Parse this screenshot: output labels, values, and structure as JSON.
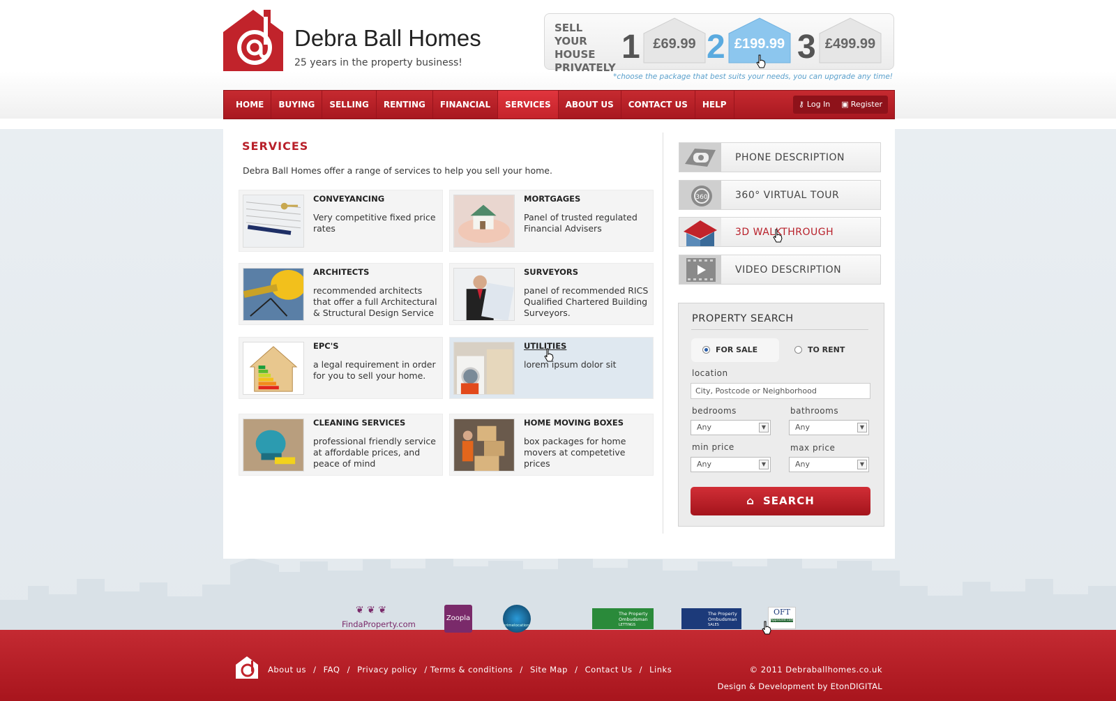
{
  "brand": {
    "name": "Debra Ball Homes",
    "tagline": "25 years in the property business!",
    "logo_icon": "house-at-logo-icon"
  },
  "promo": {
    "heading": "SELL YOUR HOUSE PRIVATELY",
    "packages": [
      {
        "num": "1",
        "price": "£69.99"
      },
      {
        "num": "2",
        "price": "£199.99"
      },
      {
        "num": "3",
        "price": "£499.99"
      }
    ],
    "note": "*choose the package that best suits your needs, you can upgrade any time!"
  },
  "nav": {
    "items": [
      "HOME",
      "BUYING",
      "SELLING",
      "RENTING",
      "FINANCIAL",
      "SERVICES",
      "ABOUT US",
      "CONTACT US",
      "HELP"
    ],
    "active": "SERVICES",
    "login": "Log In",
    "register": "Register"
  },
  "services": {
    "title": "SERVICES",
    "intro": "Debra Ball Homes offer a range of services to help you sell your home.",
    "cards": [
      {
        "title": "CONVEYANCING",
        "desc": "Very competitive fixed price rates"
      },
      {
        "title": "MORTGAGES",
        "desc": "Panel of trusted regulated Financial Advisers"
      },
      {
        "title": "ARCHITECTS",
        "desc": "recommended architects that offer a full Architectural & Structural Design Service"
      },
      {
        "title": "SURVEYORS",
        "desc": "panel of recommended RICS Qualified Chartered Building Surveyors."
      },
      {
        "title": "EPC'S",
        "desc": "a legal requirement in order for you to sell your home."
      },
      {
        "title": "UTILITIES",
        "desc": "lorem ipsum dolor sit"
      },
      {
        "title": "CLEANING SERVICES",
        "desc": "professional friendly service at affordable prices, and peace of mind"
      },
      {
        "title": "HOME MOVING BOXES",
        "desc": "box packages for home movers at competetive prices"
      }
    ]
  },
  "features": [
    {
      "label": "PHONE DESCRIPTION",
      "icon": "phone-icon"
    },
    {
      "label": "360° VIRTUAL TOUR",
      "icon": "360-tour-icon"
    },
    {
      "label": "3D WALKTHROUGH",
      "icon": "3d-house-icon"
    },
    {
      "label": "VIDEO DESCRIPTION",
      "icon": "video-icon"
    }
  ],
  "property_search": {
    "title": "PROPERTY SEARCH",
    "for_sale": "FOR SALE",
    "to_rent": "TO RENT",
    "location_label": "location",
    "location_placeholder": "City, Postcode or Neighborhood",
    "bedrooms_label": "bedrooms",
    "bathrooms_label": "bathrooms",
    "min_price_label": "min price",
    "max_price_label": "max price",
    "bedrooms_value": "Any",
    "bathrooms_value": "Any",
    "min_price_value": "Any",
    "max_price_value": "Any",
    "search_button": "SEARCH"
  },
  "partners": {
    "findaproperty": "FindaProperty.com",
    "zoopla": "Zoopla",
    "primelocation": "primelocation.com",
    "ombudsman_lettings_1": "The Property",
    "ombudsman_lettings_2": "Ombudsman",
    "ombudsman_lettings_3": "LETTINGS",
    "ombudsman_sales_1": "The Property",
    "ombudsman_sales_2": "Ombudsman",
    "ombudsman_sales_3": "SALES",
    "oft": "OFT",
    "oft_sub": "Approved code"
  },
  "footer": {
    "links": [
      "About us",
      "/",
      "FAQ",
      "/",
      "Privacy policy",
      "/ Terms & conditions",
      "/",
      "Site Map",
      "/",
      "Contact Us",
      "/",
      "Links"
    ],
    "copyright": "© 2011 Debraballhomes.co.uk",
    "credit": "Design & Development by EtonDIGITAL"
  },
  "colors": {
    "brand_red": "#b8202a",
    "accent_blue": "#5aaadf"
  }
}
